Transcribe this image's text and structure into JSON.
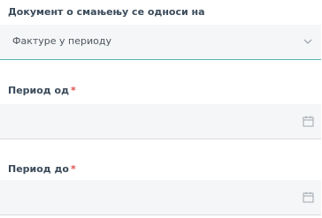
{
  "form": {
    "document_reduction": {
      "label": "Документ о смањењу се односи на",
      "value": "Фактуре у периоду",
      "icon": "chevron-down-icon"
    },
    "period_from": {
      "label": "Период од",
      "required_mark": "*",
      "value": "",
      "icon": "calendar-icon"
    },
    "period_to": {
      "label": "Период до",
      "required_mark": "*",
      "value": "",
      "icon": "calendar-icon"
    }
  },
  "colors": {
    "label": "#3a4a5a",
    "required": "#e04b4b",
    "field_bg": "#f5f6f7",
    "accent_underline": "#58b8b8",
    "icon": "#a0a7ae"
  }
}
